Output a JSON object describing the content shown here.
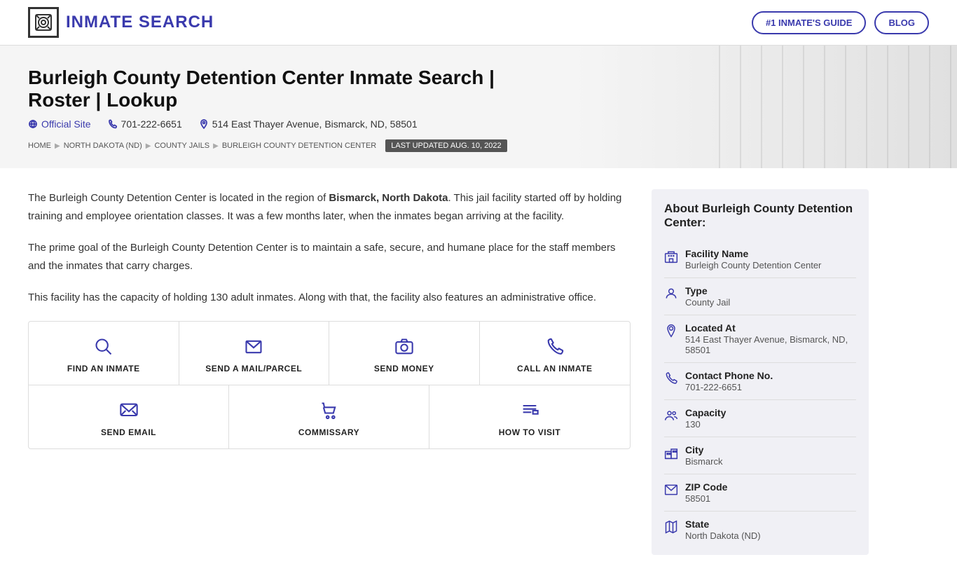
{
  "header": {
    "logo_text": "INMATE SEARCH",
    "nav_items": [
      {
        "label": "#1 INMATE'S GUIDE",
        "id": "inmates-guide-link"
      },
      {
        "label": "BLOG",
        "id": "blog-link"
      }
    ]
  },
  "hero": {
    "title": "Burleigh County Detention Center Inmate Search | Roster | Lookup",
    "official_site_label": "Official Site",
    "phone": "701-222-6651",
    "address": "514 East Thayer Avenue, Bismarck, ND, 58501",
    "breadcrumb": {
      "items": [
        "HOME",
        "NORTH DAKOTA (ND)",
        "COUNTY JAILS",
        "BURLEIGH COUNTY DETENTION CENTER"
      ],
      "last_updated": "LAST UPDATED AUG. 10, 2022"
    }
  },
  "main": {
    "paragraphs": [
      "The Burleigh County Detention Center is located in the region of Bismarck, North Dakota. This jail facility started off by holding training and employee orientation classes. It was a few months later, when the inmates began arriving at the facility.",
      "The prime goal of the Burleigh County Detention Center is to maintain a safe, secure, and humane place for the staff members and the inmates that carry charges.",
      "This facility has the capacity of holding 130 adult inmates. Along with that, the facility also features an administrative office."
    ],
    "bold_parts": [
      "Bismarck, North Dakota"
    ],
    "actions_row1": [
      {
        "label": "FIND AN INMATE",
        "icon": "search"
      },
      {
        "label": "SEND A MAIL/PARCEL",
        "icon": "mail"
      },
      {
        "label": "SEND MONEY",
        "icon": "camera"
      },
      {
        "label": "CALL AN INMATE",
        "icon": "phone"
      }
    ],
    "actions_row2": [
      {
        "label": "SEND EMAIL",
        "icon": "message"
      },
      {
        "label": "COMMISSARY",
        "icon": "cart"
      },
      {
        "label": "HOW TO VISIT",
        "icon": "list"
      }
    ]
  },
  "sidebar": {
    "title": "About Burleigh County Detention Center:",
    "fields": [
      {
        "label": "Facility Name",
        "value": "Burleigh County Detention Center",
        "icon": "building"
      },
      {
        "label": "Type",
        "value": "County Jail",
        "icon": "person"
      },
      {
        "label": "Located At",
        "value": "514 East Thayer Avenue, Bismarck, ND, 58501",
        "icon": "location"
      },
      {
        "label": "Contact Phone No.",
        "value": "701-222-6651",
        "icon": "phone"
      },
      {
        "label": "Capacity",
        "value": "130",
        "icon": "people"
      },
      {
        "label": "City",
        "value": "Bismarck",
        "icon": "building2"
      },
      {
        "label": "ZIP Code",
        "value": "58501",
        "icon": "mail"
      },
      {
        "label": "State",
        "value": "North Dakota (ND)",
        "icon": "map"
      }
    ]
  }
}
